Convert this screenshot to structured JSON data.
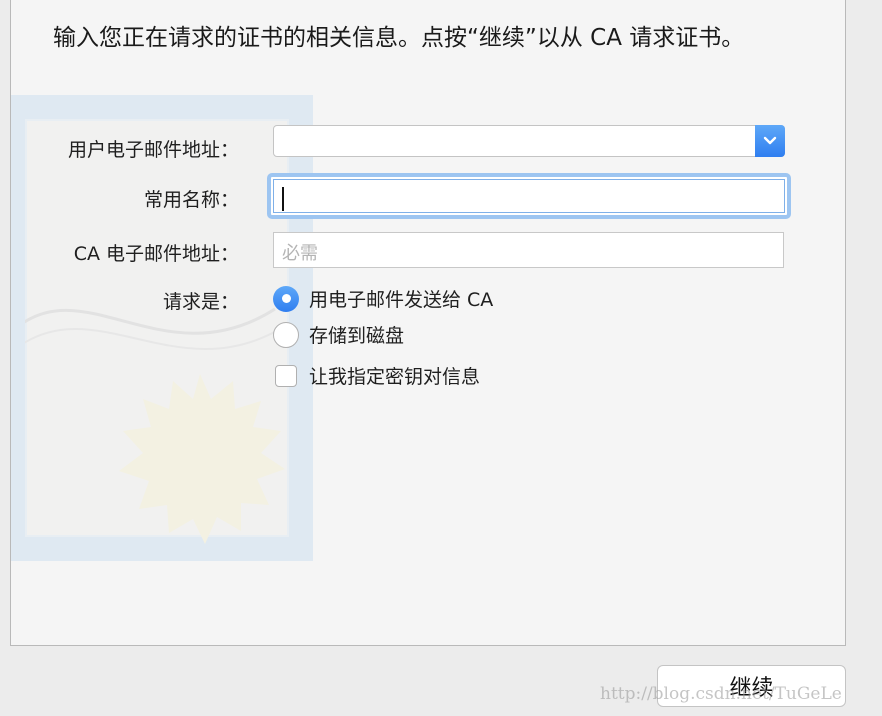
{
  "intro_text": "输入您正在请求的证书的相关信息。点按“继续”以从 CA 请求证书。",
  "form": {
    "email_label": "用户电子邮件地址：",
    "email_value": "",
    "common_name_label": "常用名称：",
    "common_name_value": "",
    "ca_email_label": "CA 电子邮件地址：",
    "ca_email_placeholder": "必需",
    "request_label": "请求是：",
    "options": [
      {
        "label": "用电子邮件发送给 CA",
        "selected": true
      },
      {
        "label": "存储到磁盘",
        "selected": false
      }
    ],
    "key_pair_checkbox": {
      "label": "让我指定密钥对信息",
      "checked": false
    }
  },
  "buttons": {
    "continue_label": "继续"
  },
  "watermark": "http://blog.csdn.net/TuGeLe",
  "colors": {
    "accent": "#3a88f2",
    "focus_ring": "#9dc5f1",
    "background": "#f5f5f5"
  },
  "icons": {
    "dropdown": "chevron-down-icon",
    "certificate": "certificate-illustration"
  }
}
